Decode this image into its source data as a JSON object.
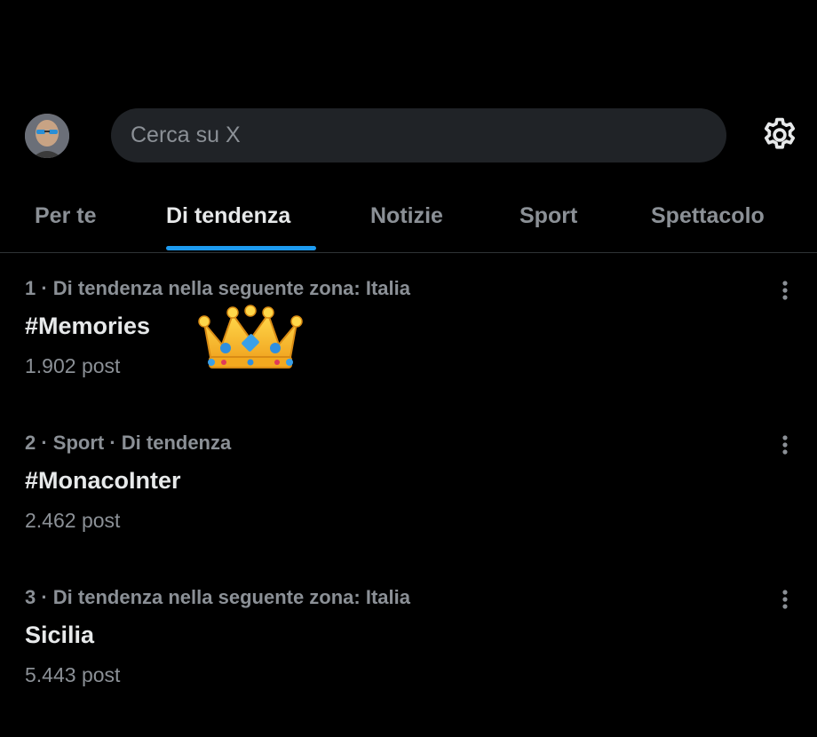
{
  "search": {
    "placeholder": "Cerca su X"
  },
  "tabs": [
    {
      "label": "Per te",
      "active": false
    },
    {
      "label": "Di tendenza",
      "active": true
    },
    {
      "label": "Notizie",
      "active": false
    },
    {
      "label": "Sport",
      "active": false
    },
    {
      "label": "Spettacolo",
      "active": false
    }
  ],
  "trends": [
    {
      "meta": "1 · Di tendenza nella seguente zona: Italia",
      "name": "#Memories",
      "count": "1.902 post"
    },
    {
      "meta": "2 · Sport · Di tendenza",
      "name": "#MonacoInter",
      "count": "2.462 post"
    },
    {
      "meta": "3 · Di tendenza nella seguente zona: Italia",
      "name": "Sicilia",
      "count": "5.443 post"
    }
  ],
  "icons": {
    "settings": "gear-icon",
    "more": "more-vertical-icon",
    "decoration": "crown-emoji"
  },
  "colors": {
    "background": "#000000",
    "accent": "#1d9bf0",
    "text_primary": "#e7e9ea",
    "text_secondary": "#8b9096",
    "search_bg": "#202327"
  }
}
